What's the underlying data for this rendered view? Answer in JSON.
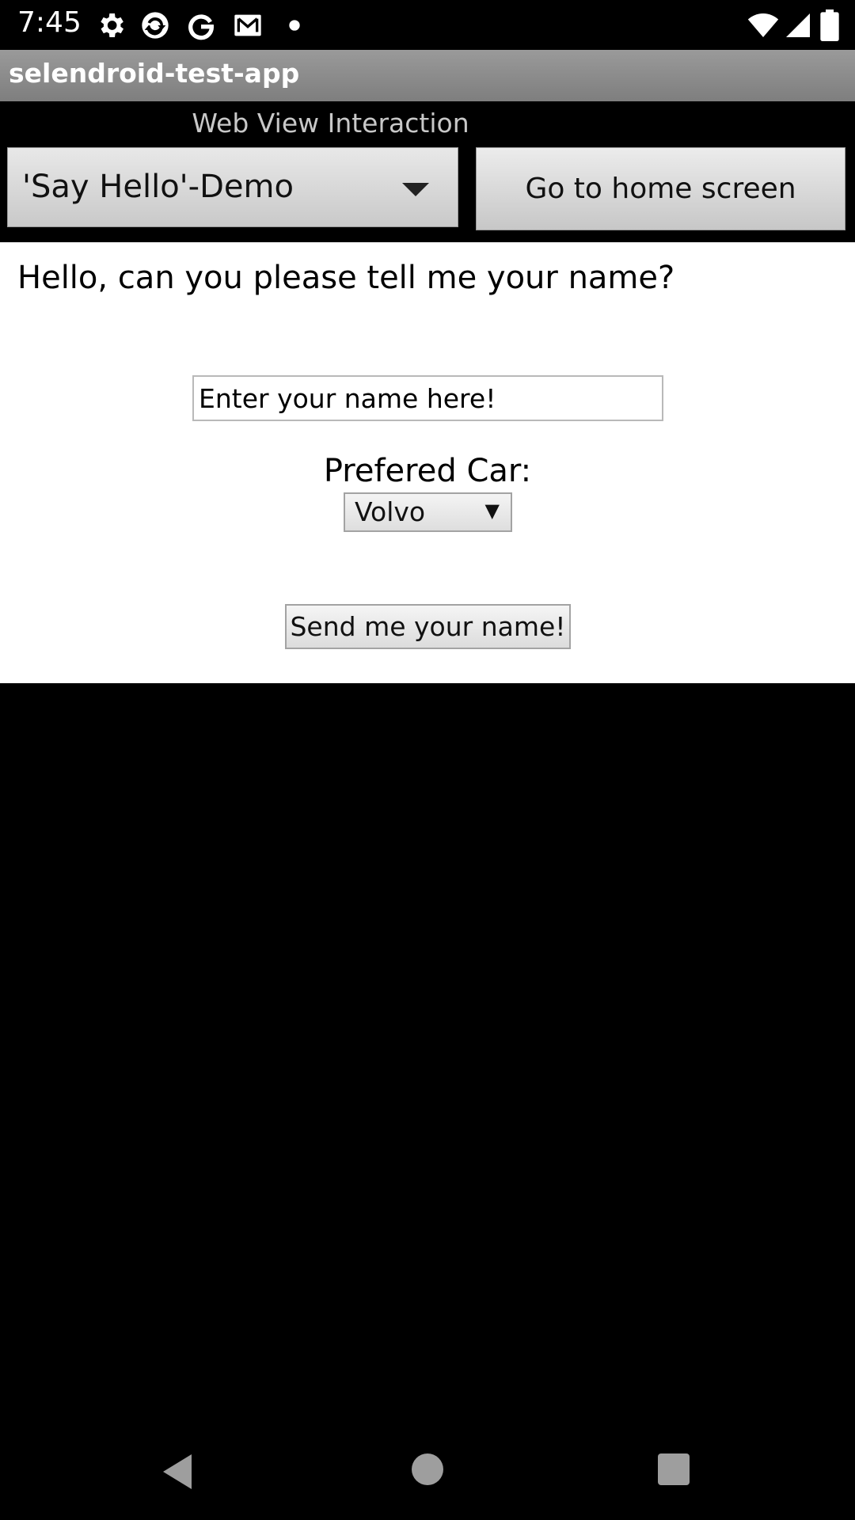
{
  "status_bar": {
    "time": "7:45",
    "left_icons": [
      "gear-icon",
      "sync-icon",
      "google-icon",
      "gmail-icon",
      "dot-icon"
    ],
    "right_icons": [
      "wifi-icon",
      "signal-icon",
      "battery-icon"
    ]
  },
  "app": {
    "title": "selendroid-test-app"
  },
  "header": {
    "activity_label": "Web View Interaction",
    "spinner_value": "'Say Hello'-Demo",
    "home_button_label": "Go to home screen"
  },
  "webview": {
    "prompt": "Hello, can you please tell me your name?",
    "name_placeholder": "Enter your name here!",
    "car_label": "Prefered Car:",
    "car_selected": "Volvo",
    "send_button_label": "Send me your name!"
  },
  "nav_bar": {
    "icons": [
      "back-icon",
      "home-icon",
      "recents-icon"
    ]
  },
  "colors": {
    "title_bar": "#8a8a8a",
    "background": "#000000",
    "webview_background": "#ffffff"
  }
}
